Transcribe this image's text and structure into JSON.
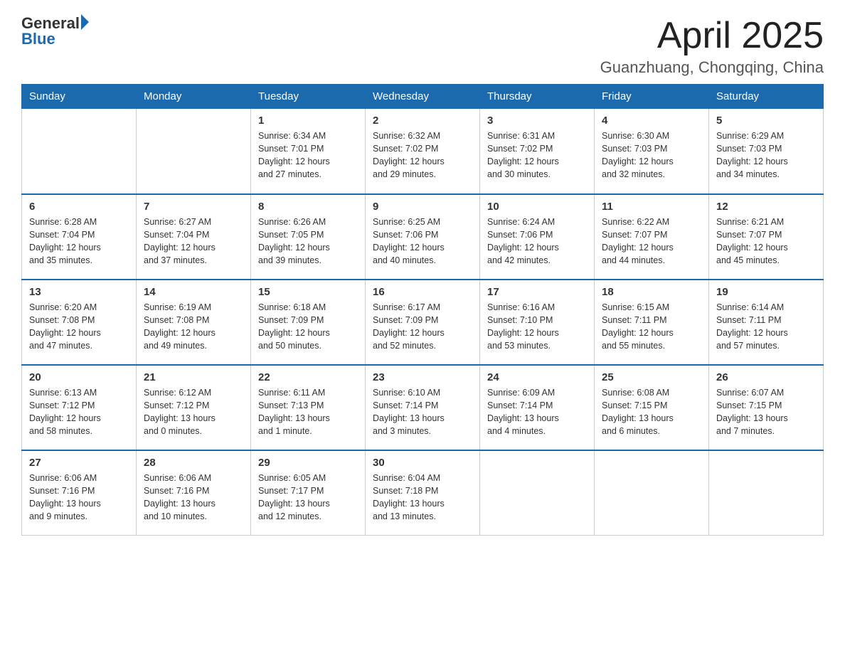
{
  "header": {
    "title": "April 2025",
    "subtitle": "Guanzhuang, Chongqing, China"
  },
  "logo": {
    "line1": "General",
    "line2": "Blue"
  },
  "days_of_week": [
    "Sunday",
    "Monday",
    "Tuesday",
    "Wednesday",
    "Thursday",
    "Friday",
    "Saturday"
  ],
  "weeks": [
    [
      {
        "day": "",
        "info": ""
      },
      {
        "day": "",
        "info": ""
      },
      {
        "day": "1",
        "info": "Sunrise: 6:34 AM\nSunset: 7:01 PM\nDaylight: 12 hours\nand 27 minutes."
      },
      {
        "day": "2",
        "info": "Sunrise: 6:32 AM\nSunset: 7:02 PM\nDaylight: 12 hours\nand 29 minutes."
      },
      {
        "day": "3",
        "info": "Sunrise: 6:31 AM\nSunset: 7:02 PM\nDaylight: 12 hours\nand 30 minutes."
      },
      {
        "day": "4",
        "info": "Sunrise: 6:30 AM\nSunset: 7:03 PM\nDaylight: 12 hours\nand 32 minutes."
      },
      {
        "day": "5",
        "info": "Sunrise: 6:29 AM\nSunset: 7:03 PM\nDaylight: 12 hours\nand 34 minutes."
      }
    ],
    [
      {
        "day": "6",
        "info": "Sunrise: 6:28 AM\nSunset: 7:04 PM\nDaylight: 12 hours\nand 35 minutes."
      },
      {
        "day": "7",
        "info": "Sunrise: 6:27 AM\nSunset: 7:04 PM\nDaylight: 12 hours\nand 37 minutes."
      },
      {
        "day": "8",
        "info": "Sunrise: 6:26 AM\nSunset: 7:05 PM\nDaylight: 12 hours\nand 39 minutes."
      },
      {
        "day": "9",
        "info": "Sunrise: 6:25 AM\nSunset: 7:06 PM\nDaylight: 12 hours\nand 40 minutes."
      },
      {
        "day": "10",
        "info": "Sunrise: 6:24 AM\nSunset: 7:06 PM\nDaylight: 12 hours\nand 42 minutes."
      },
      {
        "day": "11",
        "info": "Sunrise: 6:22 AM\nSunset: 7:07 PM\nDaylight: 12 hours\nand 44 minutes."
      },
      {
        "day": "12",
        "info": "Sunrise: 6:21 AM\nSunset: 7:07 PM\nDaylight: 12 hours\nand 45 minutes."
      }
    ],
    [
      {
        "day": "13",
        "info": "Sunrise: 6:20 AM\nSunset: 7:08 PM\nDaylight: 12 hours\nand 47 minutes."
      },
      {
        "day": "14",
        "info": "Sunrise: 6:19 AM\nSunset: 7:08 PM\nDaylight: 12 hours\nand 49 minutes."
      },
      {
        "day": "15",
        "info": "Sunrise: 6:18 AM\nSunset: 7:09 PM\nDaylight: 12 hours\nand 50 minutes."
      },
      {
        "day": "16",
        "info": "Sunrise: 6:17 AM\nSunset: 7:09 PM\nDaylight: 12 hours\nand 52 minutes."
      },
      {
        "day": "17",
        "info": "Sunrise: 6:16 AM\nSunset: 7:10 PM\nDaylight: 12 hours\nand 53 minutes."
      },
      {
        "day": "18",
        "info": "Sunrise: 6:15 AM\nSunset: 7:11 PM\nDaylight: 12 hours\nand 55 minutes."
      },
      {
        "day": "19",
        "info": "Sunrise: 6:14 AM\nSunset: 7:11 PM\nDaylight: 12 hours\nand 57 minutes."
      }
    ],
    [
      {
        "day": "20",
        "info": "Sunrise: 6:13 AM\nSunset: 7:12 PM\nDaylight: 12 hours\nand 58 minutes."
      },
      {
        "day": "21",
        "info": "Sunrise: 6:12 AM\nSunset: 7:12 PM\nDaylight: 13 hours\nand 0 minutes."
      },
      {
        "day": "22",
        "info": "Sunrise: 6:11 AM\nSunset: 7:13 PM\nDaylight: 13 hours\nand 1 minute."
      },
      {
        "day": "23",
        "info": "Sunrise: 6:10 AM\nSunset: 7:14 PM\nDaylight: 13 hours\nand 3 minutes."
      },
      {
        "day": "24",
        "info": "Sunrise: 6:09 AM\nSunset: 7:14 PM\nDaylight: 13 hours\nand 4 minutes."
      },
      {
        "day": "25",
        "info": "Sunrise: 6:08 AM\nSunset: 7:15 PM\nDaylight: 13 hours\nand 6 minutes."
      },
      {
        "day": "26",
        "info": "Sunrise: 6:07 AM\nSunset: 7:15 PM\nDaylight: 13 hours\nand 7 minutes."
      }
    ],
    [
      {
        "day": "27",
        "info": "Sunrise: 6:06 AM\nSunset: 7:16 PM\nDaylight: 13 hours\nand 9 minutes."
      },
      {
        "day": "28",
        "info": "Sunrise: 6:06 AM\nSunset: 7:16 PM\nDaylight: 13 hours\nand 10 minutes."
      },
      {
        "day": "29",
        "info": "Sunrise: 6:05 AM\nSunset: 7:17 PM\nDaylight: 13 hours\nand 12 minutes."
      },
      {
        "day": "30",
        "info": "Sunrise: 6:04 AM\nSunset: 7:18 PM\nDaylight: 13 hours\nand 13 minutes."
      },
      {
        "day": "",
        "info": ""
      },
      {
        "day": "",
        "info": ""
      },
      {
        "day": "",
        "info": ""
      }
    ]
  ]
}
